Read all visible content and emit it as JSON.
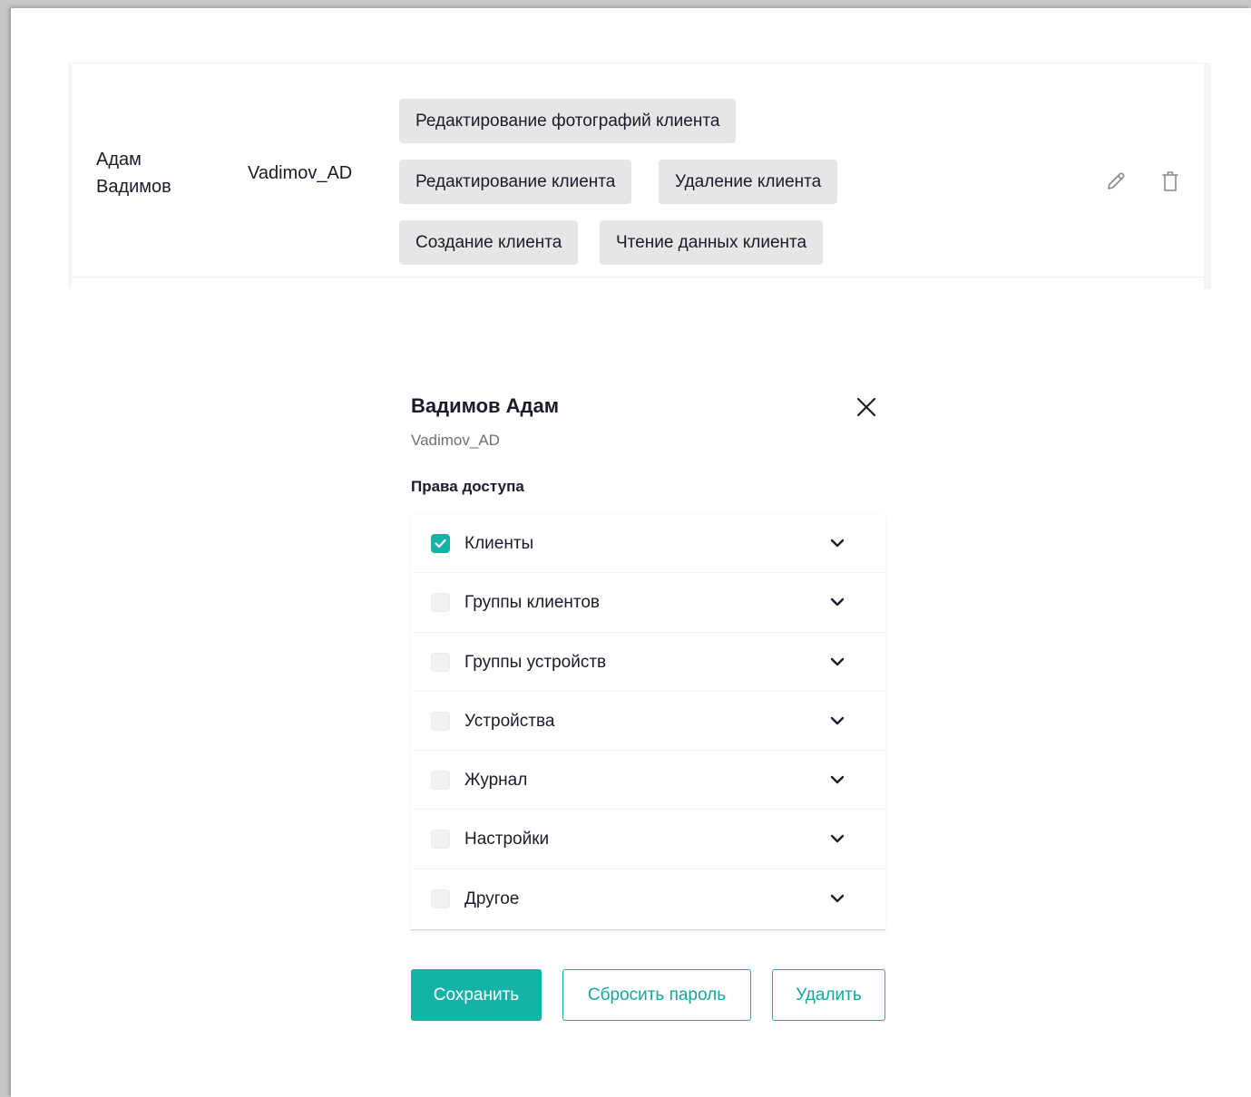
{
  "row": {
    "name": "Адам Вадимов",
    "login": "Vadimov_AD",
    "permissions": [
      "Редактирование фотографий клиента",
      "Редактирование клиента",
      "Удаление клиента",
      "Создание клиента",
      "Чтение данных клиента"
    ],
    "edit_icon": "pencil-icon",
    "delete_icon": "trash-icon"
  },
  "modal": {
    "title": "Вадимов Адам",
    "login": "Vadimov_AD",
    "close_icon": "close-icon",
    "permissions_title": "Права доступа",
    "groups": [
      {
        "label": "Клиенты",
        "checked": true
      },
      {
        "label": "Группы клиентов",
        "checked": false
      },
      {
        "label": "Группы устройств",
        "checked": false
      },
      {
        "label": "Устройства",
        "checked": false
      },
      {
        "label": "Журнал",
        "checked": false
      },
      {
        "label": "Настройки",
        "checked": false
      },
      {
        "label": "Другое",
        "checked": false
      }
    ],
    "buttons": {
      "save": "Сохранить",
      "reset_password": "Сбросить пароль",
      "delete": "Удалить"
    }
  },
  "colors": {
    "accent": "#14b3a8",
    "chip_bg": "#e6e6e6",
    "text": "#1c1b2b",
    "muted": "#707070"
  }
}
